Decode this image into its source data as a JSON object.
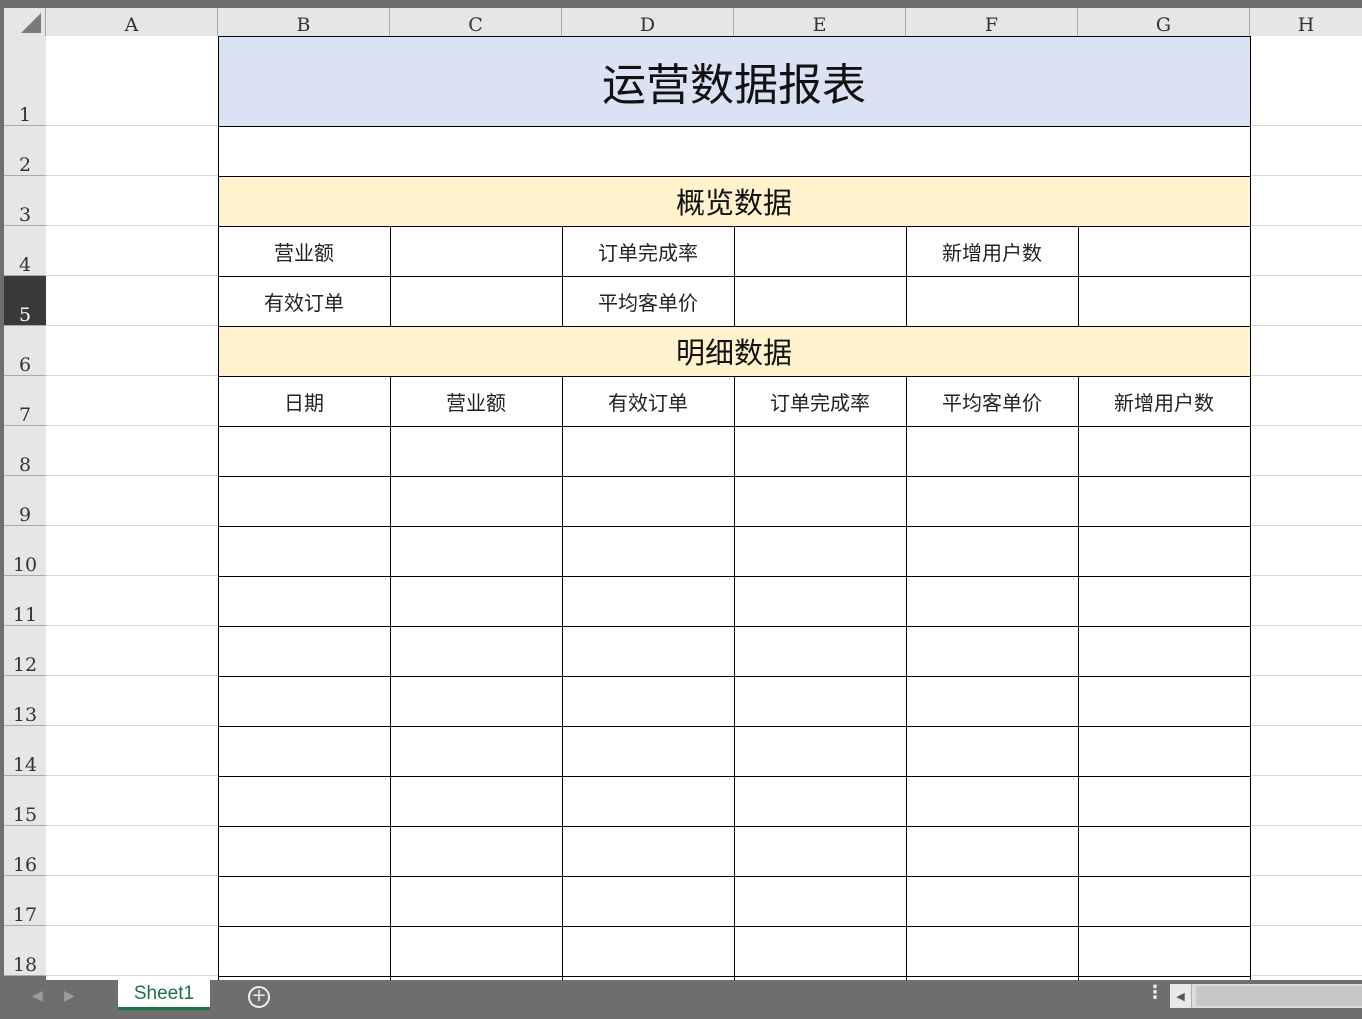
{
  "columns": [
    "A",
    "B",
    "C",
    "D",
    "E",
    "F",
    "G",
    "H"
  ],
  "rows": [
    "1",
    "2",
    "3",
    "4",
    "5",
    "6",
    "7",
    "8",
    "9",
    "10",
    "11",
    "12",
    "13",
    "14",
    "15",
    "16",
    "17",
    "18"
  ],
  "selected_row": "5",
  "report": {
    "title": "运营数据报表",
    "overview_heading": "概览数据",
    "overview_labels": {
      "revenue": "营业额",
      "completion_rate": "订单完成率",
      "new_users": "新增用户数",
      "valid_orders": "有效订单",
      "avg_order_value": "平均客单价"
    },
    "detail_heading": "明细数据",
    "detail_headers": [
      "日期",
      "营业额",
      "有效订单",
      "订单完成率",
      "平均客单价",
      "新增用户数"
    ]
  },
  "colors": {
    "title_fill": "#dae3f3",
    "section_fill": "#fff2cc",
    "tab_accent": "#1e7145"
  },
  "tabs": {
    "sheet_name": "Sheet1",
    "add_icon": "plus-circle-icon",
    "more_icon": "vertical-dots-icon"
  }
}
